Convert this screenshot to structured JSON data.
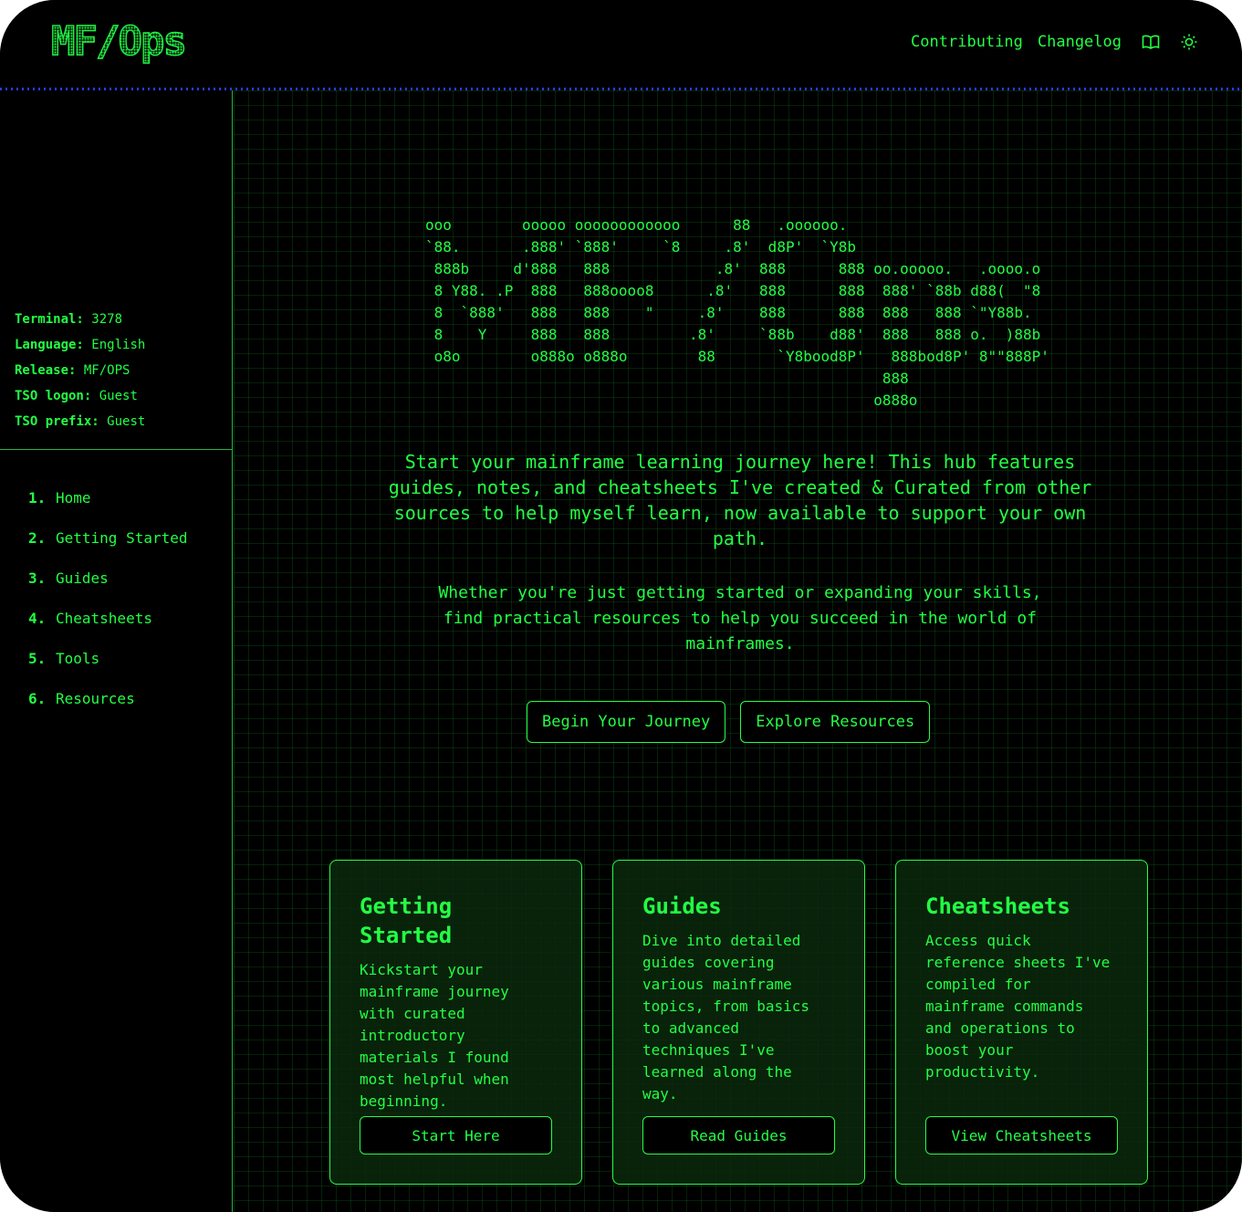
{
  "header": {
    "logo": "MF/Ops",
    "nav": [
      {
        "label": "Contributing"
      },
      {
        "label": "Changelog"
      }
    ],
    "icons": [
      "book-icon",
      "sun-icon"
    ]
  },
  "sidebar": {
    "sysinfo": [
      {
        "label": "Terminal:",
        "value": "3278"
      },
      {
        "label": "Language:",
        "value": "English"
      },
      {
        "label": "Release:",
        "value": "MF/OPS"
      },
      {
        "label": "TSO logon:",
        "value": "Guest"
      },
      {
        "label": "TSO prefix:",
        "value": "Guest"
      }
    ],
    "nav": [
      {
        "num": "1.",
        "label": "Home"
      },
      {
        "num": "2.",
        "label": "Getting Started"
      },
      {
        "num": "3.",
        "label": "Guides"
      },
      {
        "num": "4.",
        "label": "Cheatsheets"
      },
      {
        "num": "5.",
        "label": "Tools"
      },
      {
        "num": "6.",
        "label": "Resources"
      }
    ]
  },
  "main": {
    "ascii_art": "ooo        ooooo oooooooooooo      88   .oooooo.\n`88.       .888' `888'     `8     .8'  d8P'  `Y8b\n 888b     d'888   888            .8'  888      888 oo.ooooo.   .oooo.o\n 8 Y88. .P  888   888oooo8      .8'   888      888  888' `88b d88(  \"8\n 8  `888'   888   888    \"     .8'    888      888  888   888 `\"Y88b.\n 8    Y     888   888         .8'     `88b    d88'  888   888 o.  )88b\n o8o        o888o o888o        88       `Y8bood8P'   888bod8P' 8\"\"888P'\n                                                    888\n                                                   o888o",
    "intro": "Start your mainframe learning journey here! This hub features guides, notes, and cheatsheets I've created & Curated from other sources to help myself learn, now available to support your own path.",
    "intro2": "Whether you're just getting started or expanding your skills, find practical resources to help you succeed in the world of mainframes.",
    "cta_primary": "Begin Your Journey",
    "cta_secondary": "Explore Resources",
    "cards": [
      {
        "title": "Getting Started",
        "body": "Kickstart your mainframe journey with curated introductory materials I found most helpful when beginning.",
        "button": "Start Here"
      },
      {
        "title": "Guides",
        "body": "Dive into detailed guides covering various mainframe topics, from basics to advanced techniques I've learned along the way.",
        "button": "Read Guides"
      },
      {
        "title": "Cheatsheets",
        "body": "Access quick reference sheets I've compiled for mainframe commands and operations to boost your productivity.",
        "button": "View Cheatsheets"
      }
    ]
  },
  "colors": {
    "accent": "#22ff44",
    "background": "#000000",
    "header_border": "#2a3cff"
  }
}
